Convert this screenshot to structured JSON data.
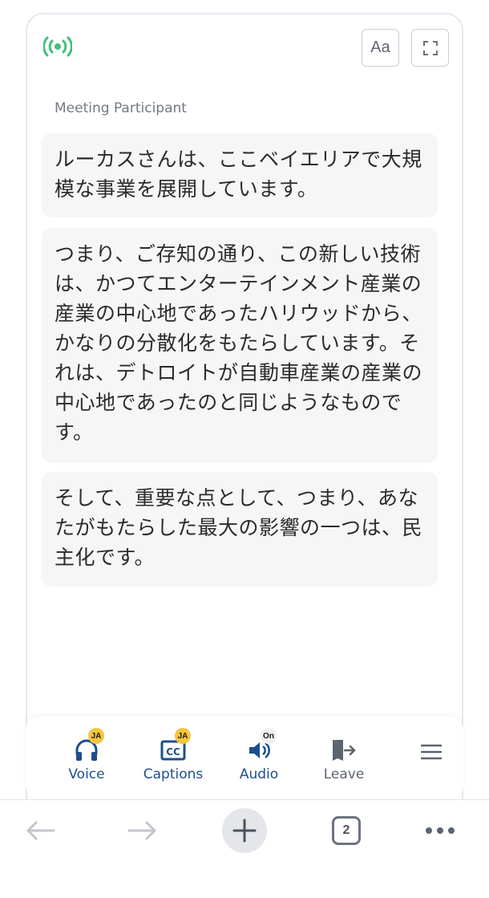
{
  "header": {
    "font_button_label": "Aa"
  },
  "transcript": {
    "speaker": "Meeting Participant",
    "messages": [
      "ルーカスさんは、ここベイエリアで大規模な事業を展開しています。",
      "つまり、ご存知の通り、この新しい技術は、かつてエンターテインメント産業の産業の中心地であったハリウッドから、かなりの分散化をもたらしています。それは、デトロイトが自動車産業の産業の中心地であったのと同じようなものです。",
      "そして、重要な点として、つまり、あなたがもたらした最大の影響の一つは、民主化です。"
    ]
  },
  "toolbar": {
    "voice": {
      "label": "Voice",
      "badge": "JA"
    },
    "captions": {
      "label": "Captions",
      "badge": "JA"
    },
    "audio": {
      "label": "Audio",
      "badge": "On"
    },
    "leave": {
      "label": "Leave"
    }
  },
  "browser": {
    "tab_count": "2"
  },
  "colors": {
    "accent_blue": "#1d4f8c",
    "live_green": "#3fc07a",
    "badge_yellow": "#f5c63d"
  }
}
